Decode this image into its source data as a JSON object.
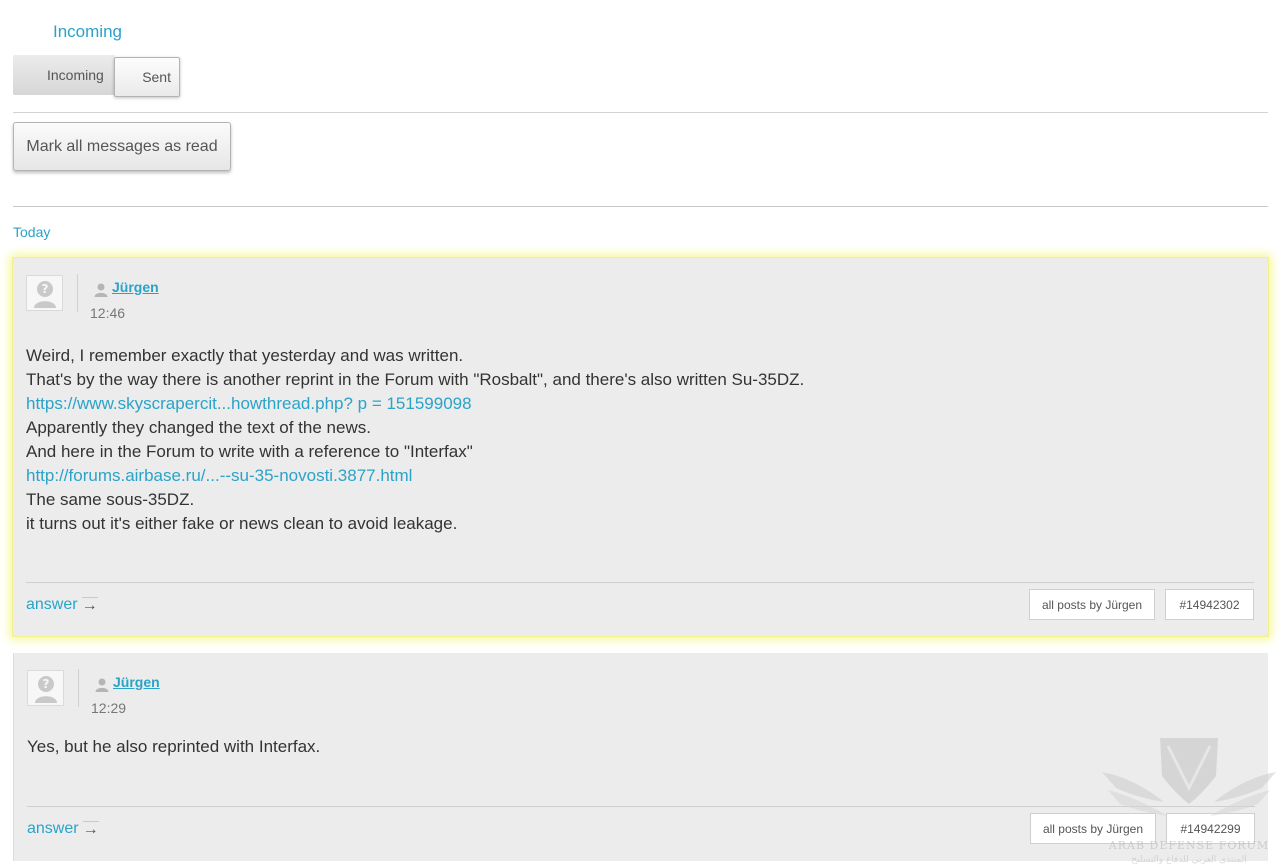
{
  "page": {
    "heading": "Incoming"
  },
  "tabs": [
    {
      "label": "Incoming",
      "active": true
    },
    {
      "label": "Sent",
      "active": false
    }
  ],
  "actions": {
    "mark_all_read": "Mark all messages as read"
  },
  "day_label": "Today",
  "messages": [
    {
      "author": "Jürgen",
      "time": "12:46",
      "lines": [
        {
          "text": "Weird, I remember exactly that yesterday and was written.",
          "link": false
        },
        {
          "text": "That's by the way there is another reprint in the Forum with \"Rosbalt\", and there's also written Su-35DZ.",
          "link": false
        },
        {
          "text": "https://www.skyscrapercit...howthread.php? p = 151599098",
          "link": true
        },
        {
          "text": "Apparently they changed the text of the news.",
          "link": false
        },
        {
          "text": "And here in the Forum to write with a reference to \"Interfax\"",
          "link": false
        },
        {
          "text": "http://forums.airbase.ru/...--su-35-novosti.3877.html",
          "link": true
        },
        {
          "text": "The same sous-35DZ.",
          "link": false
        },
        {
          "text": "it turns out it's either fake or news clean to avoid leakage.",
          "link": false
        }
      ],
      "answer_label": "answer",
      "all_posts_label": "all posts by Jürgen",
      "post_id": "#14942302",
      "highlighted": true
    },
    {
      "author": "Jürgen",
      "time": "12:29",
      "lines": [
        {
          "text": "Yes, but he also reprinted with Interfax.",
          "link": false
        }
      ],
      "answer_label": "answer",
      "all_posts_label": "all posts by Jürgen",
      "post_id": "#14942299",
      "highlighted": false
    }
  ],
  "watermark": {
    "line1": "ARAB DEFENSE FORUM",
    "line2": "المنتدى العربي للدفاع والتسليح"
  },
  "icons": {
    "avatar": "avatar-placeholder-icon",
    "user": "user-icon",
    "answer_arrow": "arrow-right-icon"
  },
  "colors": {
    "link": "#2aa3c8",
    "highlight": "#f4f68a",
    "message_bg": "#ececec"
  }
}
